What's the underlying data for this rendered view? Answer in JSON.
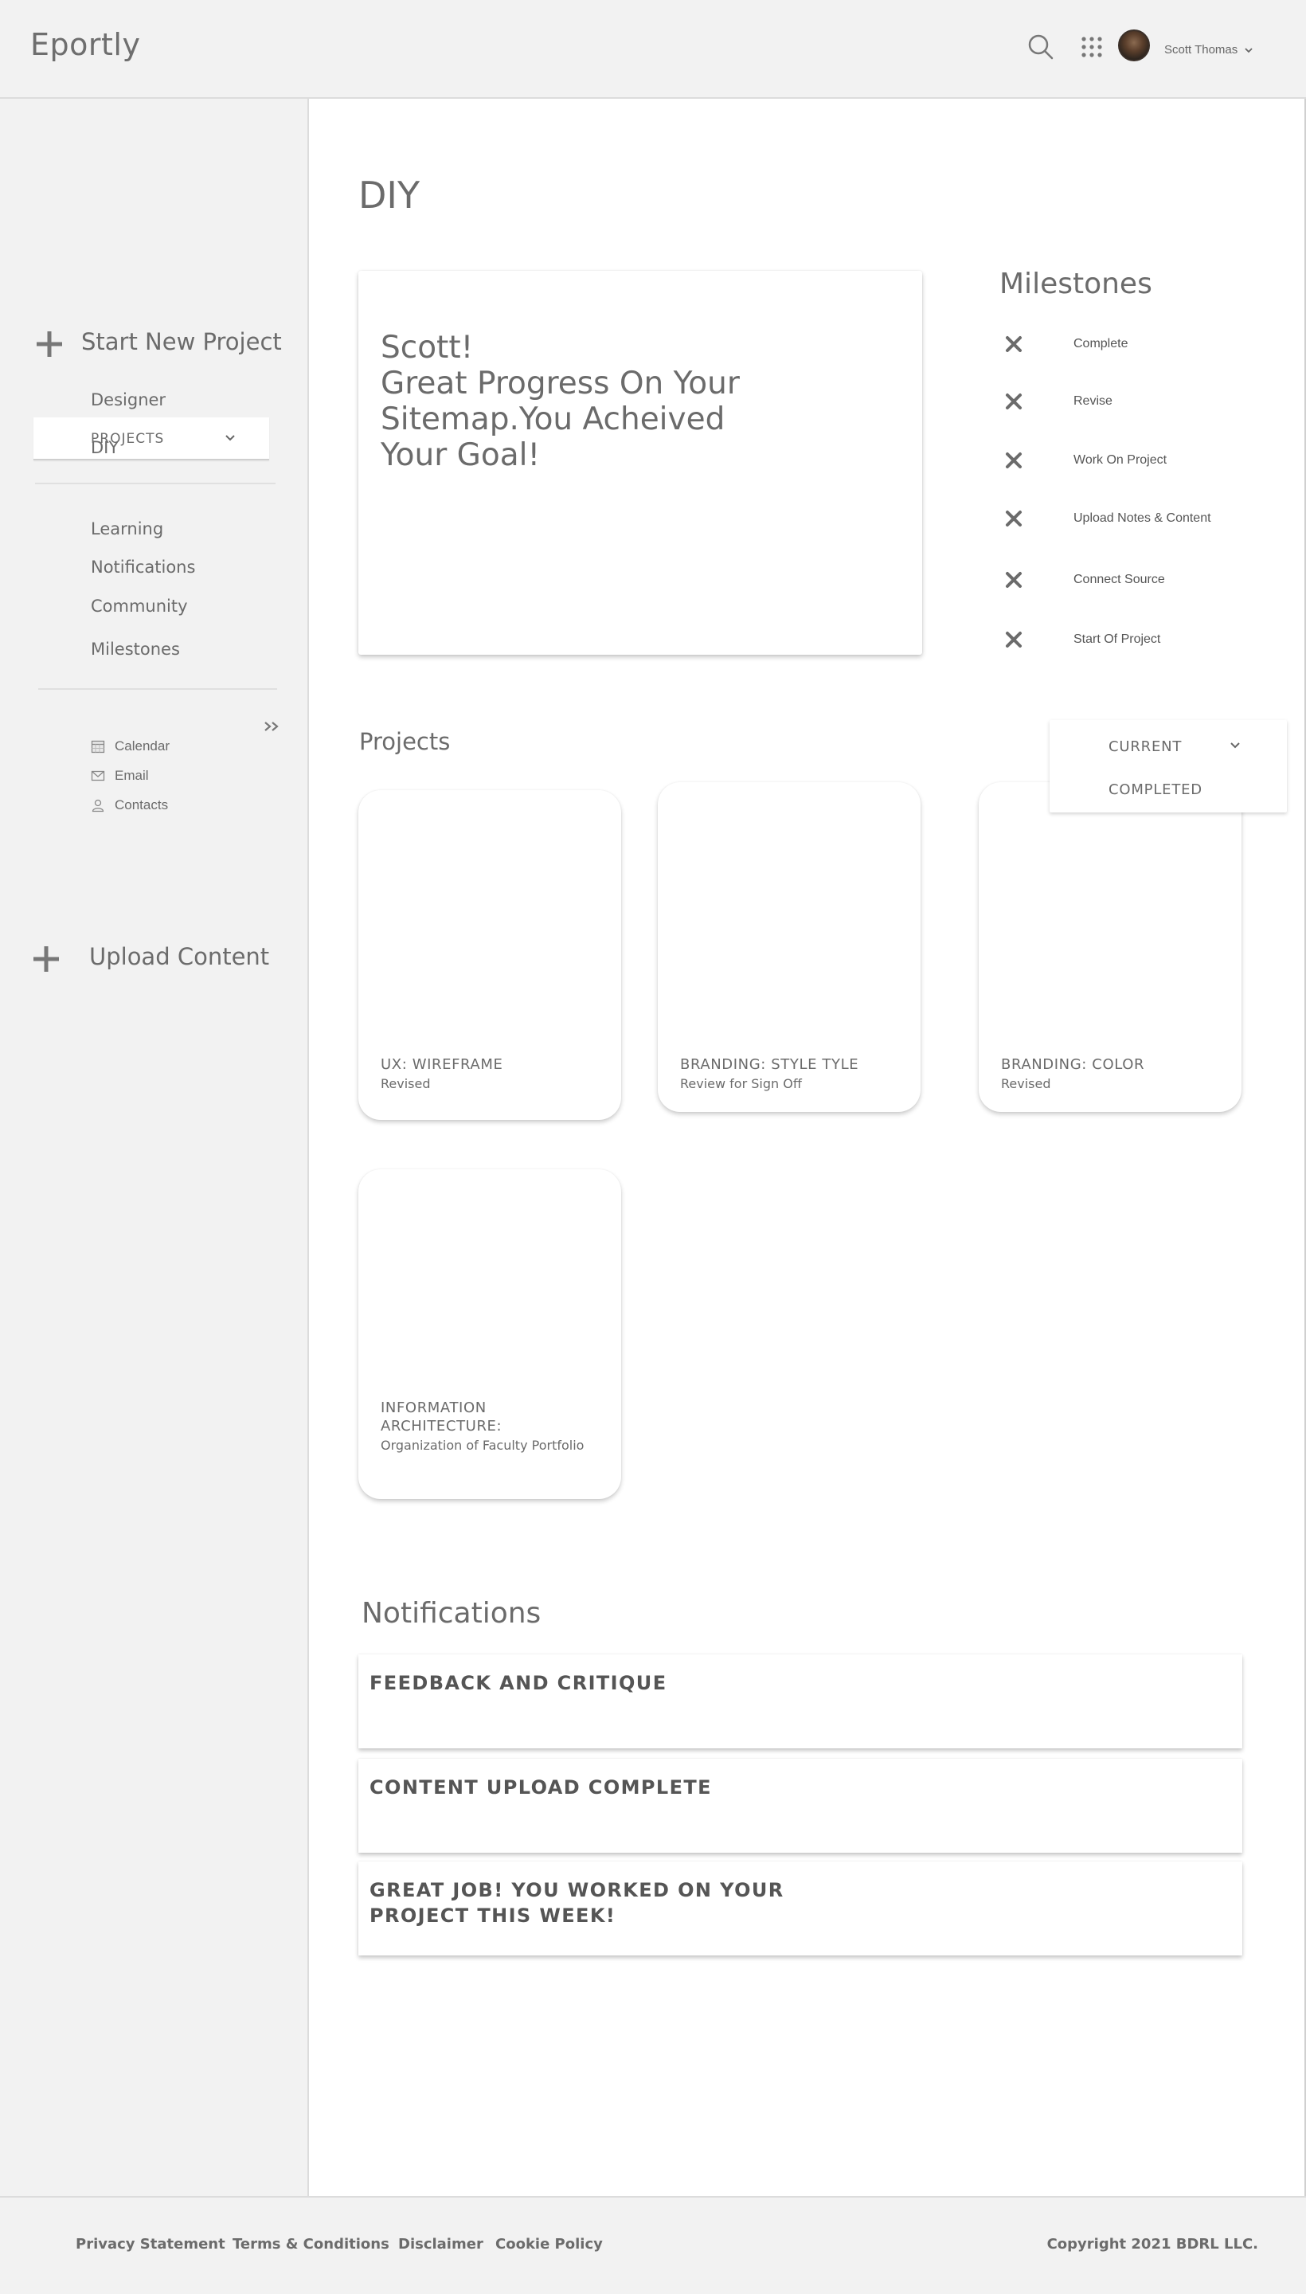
{
  "header": {
    "logo": "Eportly",
    "user_name": "Scott Thomas",
    "icons": [
      "search-icon",
      "apps-grid-icon",
      "avatar",
      "chevron-down-icon"
    ]
  },
  "sidebar": {
    "start_new_project": "Start New Project",
    "projects_select": "PROJECTS",
    "project_links": [
      "Designer",
      "DIY"
    ],
    "section_links": [
      "Learning",
      "Notifications",
      "Community",
      "Milestones"
    ],
    "util_links": [
      {
        "label": "Calendar",
        "icon": "calendar-icon"
      },
      {
        "label": "Email",
        "icon": "email-icon"
      },
      {
        "label": "Contacts",
        "icon": "contacts-icon"
      }
    ],
    "upload_content": "Upload Content"
  },
  "main": {
    "title": "DIY",
    "hero_message": "Scott!\nGreat Progress On Your Sitemap.You Acheived Your Goal!",
    "milestones": {
      "title": "Milestones",
      "items": [
        "Complete",
        "Revise",
        "Work On Project",
        "Upload Notes & Content",
        "Connect Source",
        "Start Of Project"
      ]
    },
    "projects": {
      "title": "Projects",
      "filter_options": [
        "CURRENT",
        "COMPLETED"
      ],
      "cards": [
        {
          "title": "UX: WIREFRAME",
          "status": "Revised"
        },
        {
          "title": "BRANDING: STYLE TYLE",
          "status": "Review for Sign Off"
        },
        {
          "title": "BRANDING: COLOR",
          "status": "Revised"
        },
        {
          "title": "INFORMATION ARCHITECTURE:",
          "status": "Organization of Faculty Portfolio"
        }
      ]
    },
    "notifications": {
      "title": "Notifications",
      "items": [
        "FEEDBACK AND CRITIQUE",
        "CONTENT UPLOAD COMPLETE",
        "GREAT JOB! YOU WORKED ON YOUR PROJECT THIS WEEK!"
      ]
    }
  },
  "footer": {
    "links": [
      "Privacy Statement",
      "Terms & Conditions",
      "Disclaimer",
      "Cookie Policy"
    ],
    "copyright": "Copyright 2021 BDRL LLC."
  },
  "colors": {
    "chrome_bg": "#f2f2f2",
    "text": "#6b6b6b",
    "card_bg": "#ffffff"
  }
}
